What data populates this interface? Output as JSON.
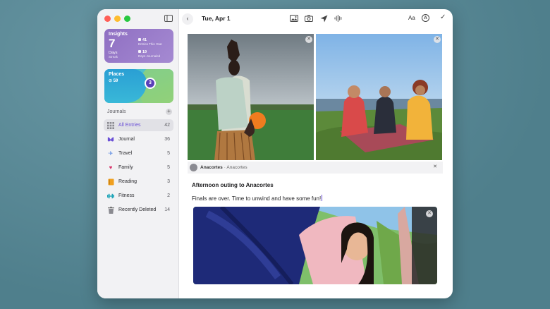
{
  "window": {
    "controls": [
      "close",
      "minimize",
      "zoom"
    ],
    "traffic_colors": [
      "#ff5f57",
      "#febc2e",
      "#28c840"
    ]
  },
  "insights": {
    "title": "Insights",
    "streak_value": "7",
    "streak_label": "Days",
    "streak_sub": "Streak",
    "entries_value": "41",
    "entries_label": "Entries This Year",
    "days_value": "19",
    "days_label": "Days Journaled"
  },
  "places": {
    "title": "Places",
    "count": "59",
    "pin_count": "3"
  },
  "journals": {
    "heading": "Journals",
    "items": [
      {
        "label": "All Entries",
        "count": "42",
        "icon": "grid-icon",
        "active": true
      },
      {
        "label": "Journal",
        "count": "36",
        "icon": "butterfly-icon"
      },
      {
        "label": "Travel",
        "count": "5",
        "icon": "airplane-icon"
      },
      {
        "label": "Family",
        "count": "5",
        "icon": "heart-icon"
      },
      {
        "label": "Reading",
        "count": "3",
        "icon": "book-icon"
      },
      {
        "label": "Fitness",
        "count": "2",
        "icon": "dumbbell-icon"
      },
      {
        "label": "Recently Deleted",
        "count": "14",
        "icon": "trash-icon"
      }
    ]
  },
  "toolbar": {
    "date": "Tue, Apr 1",
    "format_label": "Aa",
    "icons": [
      "photo-library-icon",
      "camera-icon",
      "location-arrow-icon",
      "waveform-icon",
      "markup-icon",
      "done-check-icon"
    ]
  },
  "entry": {
    "location_name": "Anacortes",
    "location_sub": "· Anacortes",
    "title": "Afternoon outing to Anacortes",
    "body": "Finals are over. Time to unwind and have some fun!"
  },
  "colors": {
    "accent": "#6a4fd6",
    "insights_gradient": [
      "#8f6fc2",
      "#a58ad2"
    ],
    "sidebar_bg": "#f2f2f4"
  }
}
